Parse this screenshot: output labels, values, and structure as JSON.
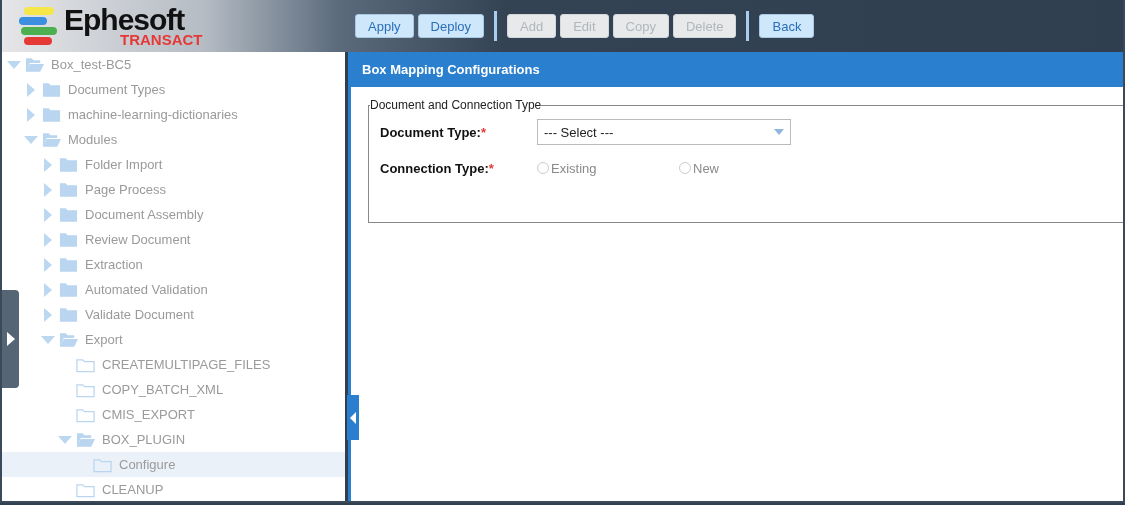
{
  "logo": {
    "name": "Ephesoft",
    "tagline": "TRANSACT"
  },
  "toolbar": {
    "groups": [
      [
        {
          "label": "Apply",
          "disabled": false
        },
        {
          "label": "Deploy",
          "disabled": false
        }
      ],
      [
        {
          "label": "Add",
          "disabled": true
        },
        {
          "label": "Edit",
          "disabled": true
        },
        {
          "label": "Copy",
          "disabled": true
        },
        {
          "label": "Delete",
          "disabled": true
        }
      ],
      [
        {
          "label": "Back",
          "disabled": false
        }
      ]
    ]
  },
  "tree": [
    {
      "label": "Box_test-BC5",
      "kind": "folder",
      "expanded": true,
      "selected": false,
      "children": [
        {
          "label": "Document Types",
          "kind": "folder",
          "expanded": false,
          "selected": false
        },
        {
          "label": "machine-learning-dictionaries",
          "kind": "folder",
          "expanded": false,
          "selected": false
        },
        {
          "label": "Modules",
          "kind": "folder",
          "expanded": true,
          "selected": false,
          "children": [
            {
              "label": "Folder Import",
              "kind": "folder",
              "expanded": false,
              "selected": false
            },
            {
              "label": "Page Process",
              "kind": "folder",
              "expanded": false,
              "selected": false
            },
            {
              "label": "Document Assembly",
              "kind": "folder",
              "expanded": false,
              "selected": false
            },
            {
              "label": "Review Document",
              "kind": "folder",
              "expanded": false,
              "selected": false
            },
            {
              "label": "Extraction",
              "kind": "folder",
              "expanded": false,
              "selected": false
            },
            {
              "label": "Automated Validation",
              "kind": "folder",
              "expanded": false,
              "selected": false
            },
            {
              "label": "Validate Document",
              "kind": "folder",
              "expanded": false,
              "selected": false
            },
            {
              "label": "Export",
              "kind": "folder",
              "expanded": true,
              "selected": false,
              "children": [
                {
                  "label": "CREATEMULTIPAGE_FILES",
                  "kind": "leaf",
                  "selected": false
                },
                {
                  "label": "COPY_BATCH_XML",
                  "kind": "leaf",
                  "selected": false
                },
                {
                  "label": "CMIS_EXPORT",
                  "kind": "leaf",
                  "selected": false
                },
                {
                  "label": "BOX_PLUGIN",
                  "kind": "folder",
                  "expanded": true,
                  "selected": false,
                  "children": [
                    {
                      "label": "Configure",
                      "kind": "leaf",
                      "selected": true
                    }
                  ]
                },
                {
                  "label": "CLEANUP",
                  "kind": "leaf",
                  "selected": false
                }
              ]
            }
          ]
        }
      ]
    }
  ],
  "panel": {
    "title": "Box Mapping Configurations",
    "fieldset": {
      "legend": "Document and Connection Type",
      "document_type": {
        "label": "Document Type:",
        "required_mark": "*",
        "value": "--- Select ---"
      },
      "connection_type": {
        "label": "Connection Type:",
        "required_mark": "*",
        "options": [
          {
            "label": "Existing",
            "selected": false
          },
          {
            "label": "New",
            "selected": false
          }
        ]
      }
    }
  }
}
